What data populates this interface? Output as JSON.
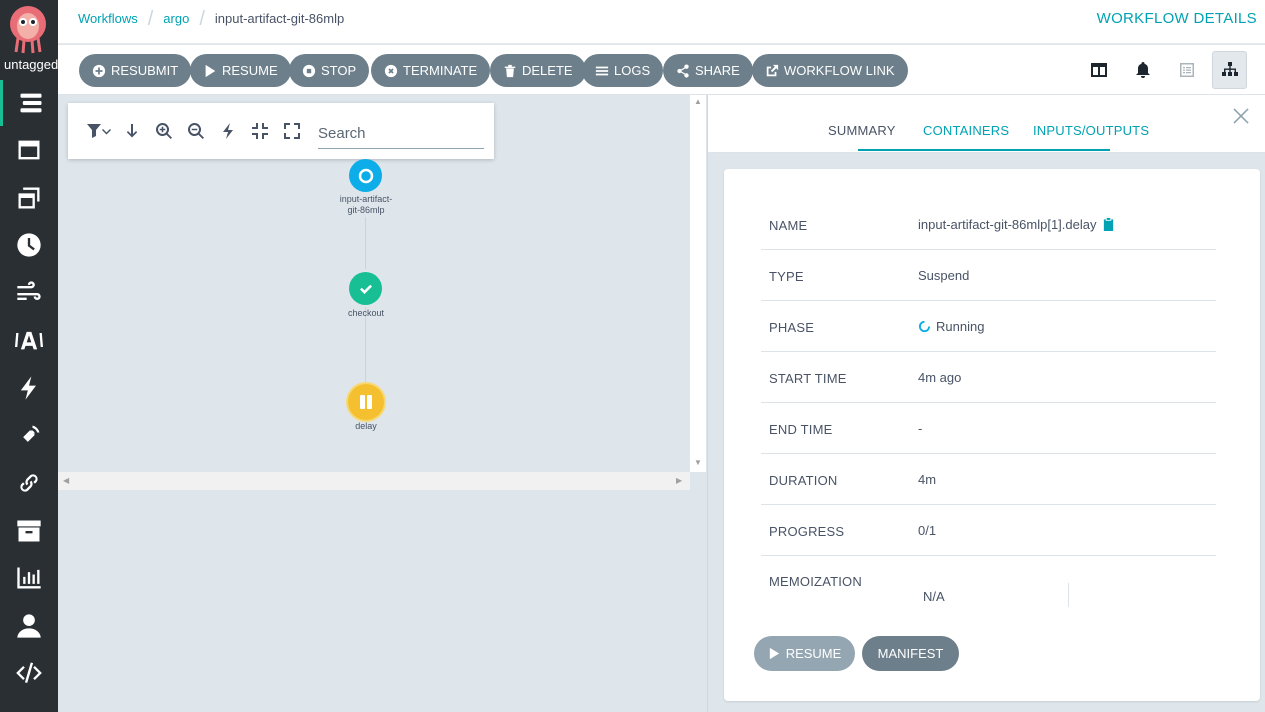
{
  "sidebar": {
    "version": "untagged",
    "items": [
      "workflows-icon",
      "workflow-templates-icon",
      "cluster-workflow-templates-icon",
      "cron-workflows-icon",
      "event-flow-icon",
      "event-sources-icon",
      "sensors-icon",
      "event-bus-icon",
      "links-icon",
      "archived-workflows-icon",
      "reports-icon",
      "user-icon",
      "api-docs-icon",
      "help-icon"
    ]
  },
  "header": {
    "breadcrumb": [
      "Workflows",
      "argo",
      "input-artifact-git-86mlp"
    ],
    "title": "WORKFLOW DETAILS"
  },
  "toolbar": {
    "buttons": [
      {
        "label": "RESUBMIT",
        "icon": "plus-circle-icon"
      },
      {
        "label": "RESUME",
        "icon": "play-icon"
      },
      {
        "label": "STOP",
        "icon": "stop-circle-icon"
      },
      {
        "label": "TERMINATE",
        "icon": "times-circle-icon"
      },
      {
        "label": "DELETE",
        "icon": "trash-icon"
      },
      {
        "label": "LOGS",
        "icon": "bars-icon"
      },
      {
        "label": "SHARE",
        "icon": "share-icon"
      },
      {
        "label": "WORKFLOW LINK",
        "icon": "external-link-icon"
      }
    ],
    "views": [
      "columns-icon",
      "bell-icon",
      "events-list-icon",
      "sitemap-icon"
    ]
  },
  "graph": {
    "search_placeholder": "Search",
    "nodes": [
      {
        "label": "input-artifact-\ngit-86mlp",
        "status": "Running"
      },
      {
        "label": "checkout",
        "status": "Succeeded"
      },
      {
        "label": "delay",
        "status": "Suspended"
      }
    ]
  },
  "details": {
    "tabs": [
      "SUMMARY",
      "CONTAINERS",
      "INPUTS/OUTPUTS"
    ],
    "active_tab": "SUMMARY",
    "rows": [
      {
        "key": "NAME",
        "value": "input-artifact-git-86mlp[1].delay"
      },
      {
        "key": "TYPE",
        "value": "Suspend"
      },
      {
        "key": "PHASE",
        "value": "Running"
      },
      {
        "key": "START TIME",
        "value": "4m ago"
      },
      {
        "key": "END TIME",
        "value": "-"
      },
      {
        "key": "DURATION",
        "value": "4m"
      },
      {
        "key": "PROGRESS",
        "value": "0/1"
      },
      {
        "key": "MEMOIZATION",
        "value": "N/A"
      }
    ],
    "buttons": {
      "resume": "RESUME",
      "manifest": "MANIFEST"
    }
  },
  "colors": {
    "sidebar": "#2a2f33",
    "accent": "#00a2b3",
    "button": "#6d7f8b",
    "running": "#0dadea",
    "succeeded": "#18be94",
    "suspended": "#f4c030"
  }
}
